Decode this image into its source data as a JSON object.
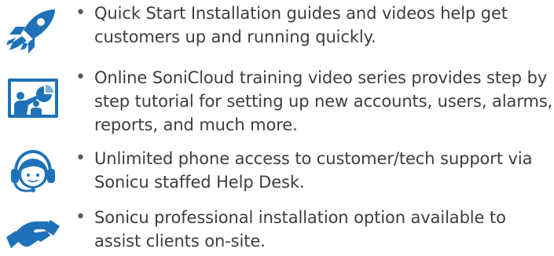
{
  "colors": {
    "icon_blue": "#1f72b8",
    "text": "#3d3d3d",
    "bullet": "#5a5a5a"
  },
  "features": [
    {
      "icon": "rocket-icon",
      "bullet": "•",
      "text": "Quick Start Installation guides and videos help get customers up and running quickly."
    },
    {
      "icon": "presentation-training-icon",
      "bullet": "•",
      "text": "Online SoniCloud training video series provides step by step tutorial for setting up new accounts, users, alarms, reports, and much more."
    },
    {
      "icon": "support-headset-icon",
      "bullet": "•",
      "text": "Unlimited phone access to customer/tech support via Sonicu staffed Help Desk."
    },
    {
      "icon": "handshake-icon",
      "bullet": "•",
      "text": "Sonicu professional installation option available to assist clients on-site."
    }
  ]
}
